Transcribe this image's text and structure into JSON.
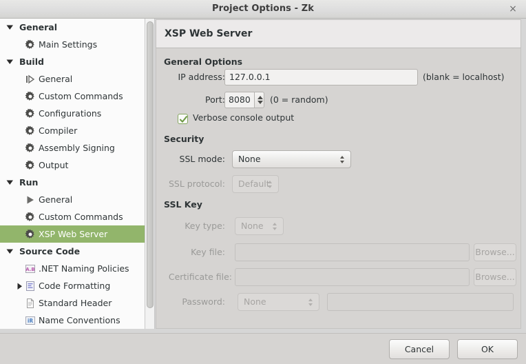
{
  "window": {
    "title": "Project Options - Zk",
    "close_label": "×"
  },
  "sidebar": {
    "items": [
      {
        "label": "General",
        "level": 0,
        "icon": "expander-down",
        "selected": false
      },
      {
        "label": "Main Settings",
        "level": 1,
        "icon": "gear-icon",
        "selected": false
      },
      {
        "label": "Build",
        "level": 0,
        "icon": "expander-down",
        "selected": false
      },
      {
        "label": "General",
        "level": 1,
        "icon": "play-bar-icon",
        "selected": false
      },
      {
        "label": "Custom Commands",
        "level": 1,
        "icon": "gear-icon",
        "selected": false
      },
      {
        "label": "Configurations",
        "level": 1,
        "icon": "gear-icon",
        "selected": false
      },
      {
        "label": "Compiler",
        "level": 1,
        "icon": "gear-icon",
        "selected": false
      },
      {
        "label": "Assembly Signing",
        "level": 1,
        "icon": "gear-icon",
        "selected": false
      },
      {
        "label": "Output",
        "level": 1,
        "icon": "gear-icon",
        "selected": false
      },
      {
        "label": "Run",
        "level": 0,
        "icon": "expander-down",
        "selected": false
      },
      {
        "label": "General",
        "level": 1,
        "icon": "play-icon",
        "selected": false
      },
      {
        "label": "Custom Commands",
        "level": 1,
        "icon": "gear-icon",
        "selected": false
      },
      {
        "label": "XSP Web Server",
        "level": 1,
        "icon": "gear-icon",
        "selected": true
      },
      {
        "label": "Source Code",
        "level": 0,
        "icon": "expander-down",
        "selected": false
      },
      {
        "label": ".NET Naming Policies",
        "level": 1,
        "icon": "ab-label-icon",
        "selected": false
      },
      {
        "label": "Code Formatting",
        "level": 1,
        "icon": "doc-lines-icon",
        "selected": false,
        "expander": "expander-right"
      },
      {
        "label": "Standard Header",
        "level": 1,
        "icon": "document-icon",
        "selected": false
      },
      {
        "label": "Name Conventions",
        "level": 1,
        "icon": "ir-label-icon",
        "selected": false
      }
    ],
    "selection_color": "#92b56b"
  },
  "panel": {
    "title": "XSP Web Server",
    "sections": {
      "general": {
        "title": "General Options",
        "ip_label": "IP address:",
        "ip_value": "127.0.0.1",
        "ip_hint": "(blank = localhost)",
        "port_label": "Port:",
        "port_value": "8080",
        "port_hint": "(0 = random)",
        "verbose_label": "Verbose console output",
        "verbose_checked": true
      },
      "security": {
        "title": "Security",
        "ssl_mode_label": "SSL mode:",
        "ssl_mode_value": "None",
        "ssl_protocol_label": "SSL protocol:",
        "ssl_protocol_value": "Default"
      },
      "ssl_key": {
        "title": "SSL Key",
        "key_type_label": "Key type:",
        "key_type_value": "None",
        "key_file_label": "Key file:",
        "key_file_value": "",
        "key_file_browse": "Browse...",
        "cert_file_label": "Certificate file:",
        "cert_file_value": "",
        "cert_file_browse": "Browse...",
        "password_label": "Password:",
        "password_mode_value": "None",
        "password_value": ""
      }
    }
  },
  "actions": {
    "cancel_label": "Cancel",
    "ok_label": "OK"
  }
}
